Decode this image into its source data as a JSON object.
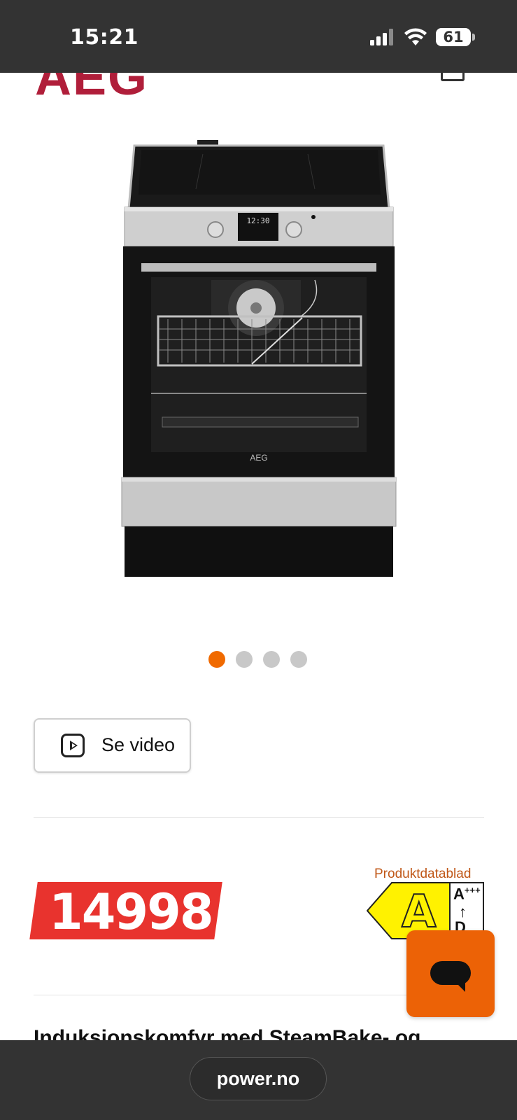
{
  "status_bar": {
    "time": "15:21",
    "battery": "61",
    "icons": [
      "cellular-signal-icon",
      "wifi-icon",
      "battery-icon"
    ]
  },
  "header": {
    "logo_text": "AEG",
    "icons": [
      "cart-icon"
    ]
  },
  "product_image": {
    "display_text": "12:30",
    "brand_text": "AEG"
  },
  "carousel": {
    "count": 4,
    "active_index": 0,
    "active_color": "#f06a00",
    "inactive_color": "#c8c8c8"
  },
  "video_button": {
    "label": "Se video",
    "icon": "play-icon"
  },
  "price": {
    "value": "14998",
    "badge_color": "#e8332e"
  },
  "energy": {
    "datasheet_link": "Produktdatablad",
    "class": "A",
    "scale_top": "A",
    "scale_top_sup": "+++",
    "scale_arrow": "↑",
    "scale_bottom": "D",
    "label_color": "#fff200"
  },
  "chat": {
    "icon": "chat-icon",
    "color": "#ec6206"
  },
  "product": {
    "title": "Induksjonskomfyr med SteamBake- og"
  },
  "browser": {
    "url": "power.no"
  }
}
